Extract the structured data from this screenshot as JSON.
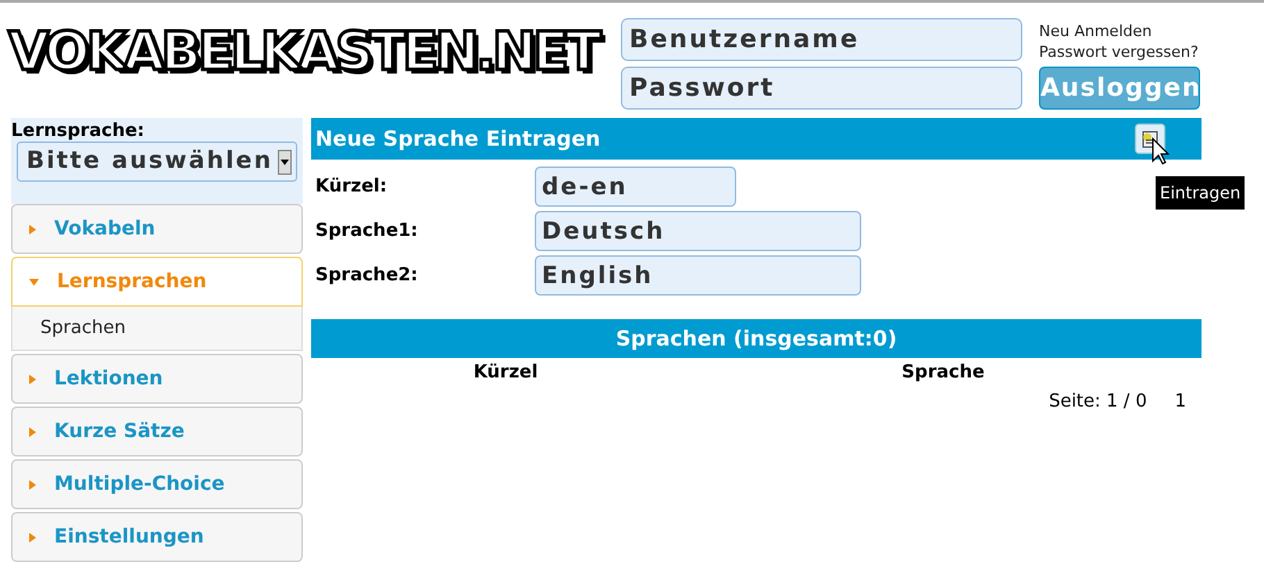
{
  "logo": "VOKABELKASTEN.NET",
  "login": {
    "username": {
      "placeholder": "Benutzername"
    },
    "password": {
      "placeholder": "Passwort"
    },
    "links": [
      "Neu Anmelden",
      "Passwort vergessen?"
    ],
    "button": "Ausloggen"
  },
  "sidebar": {
    "label": "Lernsprache:",
    "select": "Bitte auswählen",
    "items": [
      {
        "label": "Vokabeln",
        "expanded": false
      },
      {
        "label": "Lernsprachen",
        "expanded": true,
        "children": [
          {
            "label": "Sprachen"
          }
        ]
      },
      {
        "label": "Lektionen",
        "expanded": false
      },
      {
        "label": "Kurze Sätze",
        "expanded": false
      },
      {
        "label": "Multiple-Choice",
        "expanded": false
      },
      {
        "label": "Einstellungen",
        "expanded": false
      }
    ]
  },
  "form": {
    "title": "Neue Sprache Eintragen",
    "tooltip": "Eintragen",
    "fields": [
      {
        "label": "Kürzel:",
        "value": "de-en"
      },
      {
        "label": "Sprache1:",
        "value": "Deutsch"
      },
      {
        "label": "Sprache2:",
        "value": "English"
      }
    ]
  },
  "table": {
    "title": "Sprachen (insgesamt:0)",
    "columns": [
      "Kürzel",
      "Sprache"
    ],
    "pager": "Seite: 1 / 0",
    "page": "1"
  }
}
